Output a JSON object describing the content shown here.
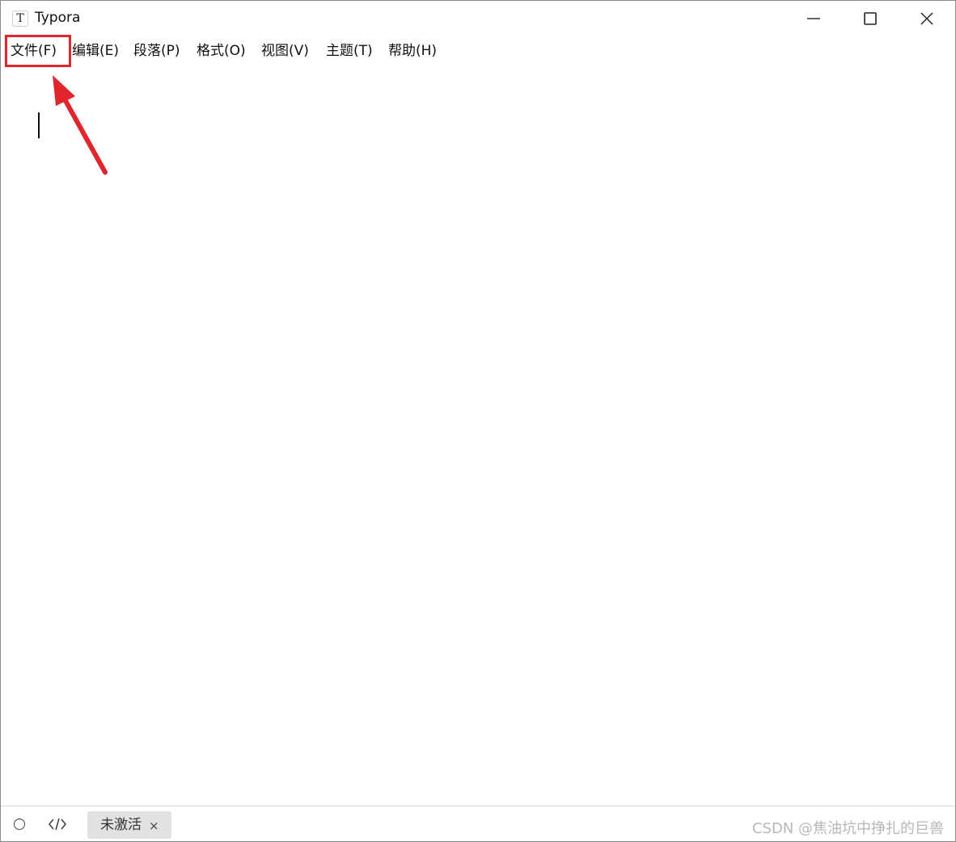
{
  "window": {
    "title": "Typora",
    "icon_letter": "T"
  },
  "menu": [
    {
      "label": "文件(F)"
    },
    {
      "label": "编辑(E)"
    },
    {
      "label": "段落(P)"
    },
    {
      "label": "格式(O)"
    },
    {
      "label": "视图(V)"
    },
    {
      "label": "主题(T)"
    },
    {
      "label": "帮助(H)"
    }
  ],
  "status": {
    "tag_label": "未激活",
    "tag_close": "×"
  },
  "watermark": "CSDN @焦油坑中挣扎的巨兽",
  "colors": {
    "annotation": "#e0252d"
  },
  "icons": {
    "status_left": "circle-icon",
    "source_mode": "code-brackets-icon"
  }
}
